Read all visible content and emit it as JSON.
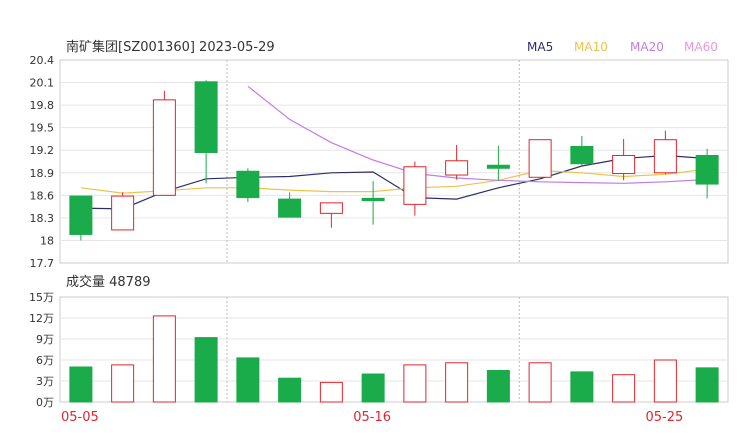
{
  "chart_data": [
    {
      "type": "candlestick",
      "title": "南矿集团[SZ001360] 2023-05-29",
      "legend": [
        {
          "name": "MA5",
          "color": "#2b2f6b"
        },
        {
          "name": "MA10",
          "color": "#f0c24b"
        },
        {
          "name": "MA20",
          "color": "#c17ee0"
        },
        {
          "name": "MA60",
          "color": "#e89ad6"
        }
      ],
      "y_ticks": [
        "20.4",
        "20.1",
        "19.8",
        "19.5",
        "19.2",
        "18.9",
        "18.6",
        "18.3",
        "18",
        "17.7"
      ],
      "ylim": [
        17.7,
        20.4
      ],
      "date_labels": [
        {
          "index": 0,
          "label": "05-05"
        },
        {
          "index": 7,
          "label": "05-16"
        },
        {
          "index": 14,
          "label": "05-25"
        }
      ],
      "separators_after_index": [
        3,
        10
      ],
      "up_color": "#e0262e",
      "down_color": "#1aab4a",
      "candles": [
        {
          "open": 18.59,
          "close": 18.08,
          "high": 18.59,
          "low": 18.0
        },
        {
          "open": 18.14,
          "close": 18.59,
          "high": 18.64,
          "low": 18.14
        },
        {
          "open": 18.6,
          "close": 19.87,
          "high": 19.99,
          "low": 18.6
        },
        {
          "open": 20.11,
          "close": 19.17,
          "high": 20.13,
          "low": 18.76
        },
        {
          "open": 18.92,
          "close": 18.57,
          "high": 18.96,
          "low": 18.51
        },
        {
          "open": 18.55,
          "close": 18.31,
          "high": 18.64,
          "low": 18.31
        },
        {
          "open": 18.36,
          "close": 18.5,
          "high": 18.5,
          "low": 18.17
        },
        {
          "open": 18.56,
          "close": 18.53,
          "high": 18.79,
          "low": 18.21
        },
        {
          "open": 18.48,
          "close": 18.98,
          "high": 19.05,
          "low": 18.33
        },
        {
          "open": 18.87,
          "close": 19.06,
          "high": 19.27,
          "low": 18.81
        },
        {
          "open": 19.0,
          "close": 18.96,
          "high": 19.26,
          "low": 18.79
        },
        {
          "open": 18.84,
          "close": 19.34,
          "high": 19.34,
          "low": 18.84
        },
        {
          "open": 19.25,
          "close": 19.02,
          "high": 19.39,
          "low": 19.0
        },
        {
          "open": 18.89,
          "close": 19.13,
          "high": 19.35,
          "low": 18.8
        },
        {
          "open": 18.9,
          "close": 19.34,
          "high": 19.46,
          "low": 18.88
        },
        {
          "open": 19.13,
          "close": 18.75,
          "high": 19.22,
          "low": 18.56
        }
      ],
      "ma_lines": [
        {
          "name": "MA5",
          "color": "#2b2f6b",
          "start_index": 0,
          "values": [
            18.43,
            18.42,
            18.65,
            18.82,
            18.84,
            18.85,
            18.9,
            18.91,
            18.57,
            18.55,
            18.7,
            18.82,
            18.99,
            19.09,
            19.13,
            19.09
          ]
        },
        {
          "name": "MA10",
          "color": "#f0c24b",
          "start_index": 0,
          "values": [
            18.7,
            18.63,
            18.66,
            18.7,
            18.7,
            18.67,
            18.65,
            18.65,
            18.7,
            18.72,
            18.8,
            18.93,
            18.9,
            18.85,
            18.88,
            18.95
          ]
        },
        {
          "name": "MA20",
          "color": "#c17ee0",
          "start_index": 4,
          "values": [
            20.05,
            19.61,
            19.3,
            19.07,
            18.89,
            18.83,
            18.8,
            18.78,
            18.77,
            18.76,
            18.78,
            18.81
          ]
        }
      ]
    },
    {
      "type": "bar",
      "title": "成交量 48789",
      "y_ticks": [
        "15万",
        "12万",
        "9万",
        "6万",
        "3万",
        "0万"
      ],
      "ylim": [
        0,
        150000
      ],
      "values": [
        50000,
        53000,
        123000,
        92000,
        63000,
        34000,
        28000,
        40000,
        53000,
        56000,
        45000,
        56000,
        43000,
        39000,
        60000,
        48789
      ],
      "directions": [
        "down",
        "up",
        "up",
        "down",
        "down",
        "down",
        "up",
        "down",
        "up",
        "up",
        "down",
        "up",
        "down",
        "up",
        "up",
        "down"
      ]
    }
  ]
}
